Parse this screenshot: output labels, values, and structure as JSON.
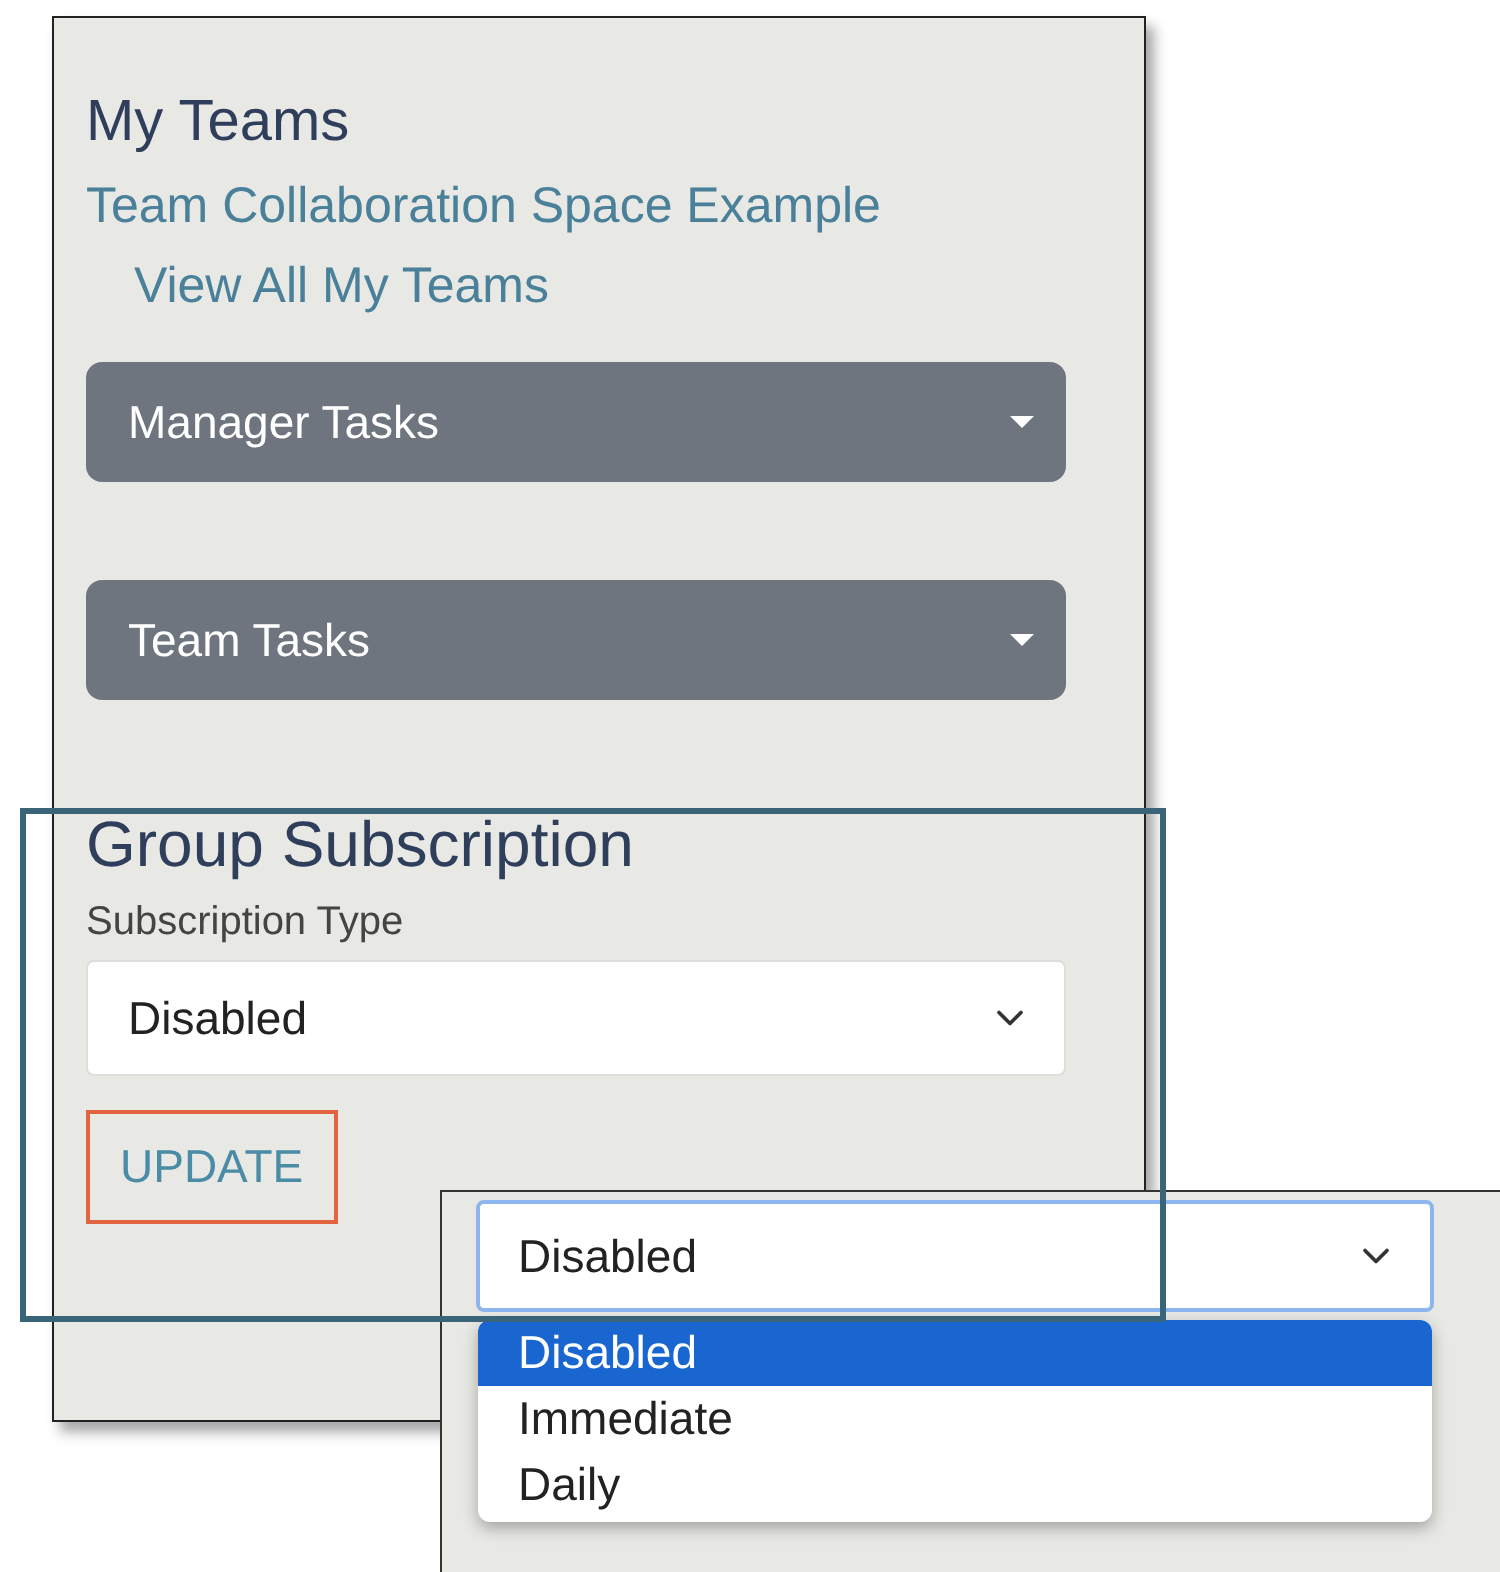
{
  "my_teams": {
    "title": "My Teams",
    "team_link": "Team Collaboration Space Example",
    "view_all_link": "View All My Teams"
  },
  "menus": [
    {
      "label": "Manager Tasks"
    },
    {
      "label": "Team Tasks"
    }
  ],
  "group_subscription": {
    "title": "Group Subscription",
    "field_label": "Subscription Type",
    "value": "Disabled",
    "button": "UPDATE"
  },
  "dropdown_inset": {
    "value": "Disabled",
    "options": [
      {
        "label": "Disabled",
        "selected": true
      },
      {
        "label": "Immediate",
        "selected": false
      },
      {
        "label": "Daily",
        "selected": false
      }
    ]
  }
}
